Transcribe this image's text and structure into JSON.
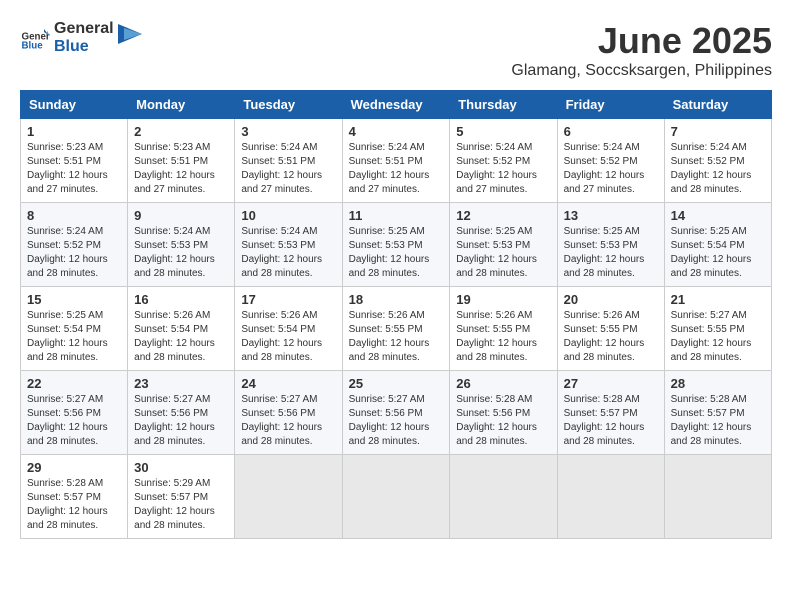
{
  "logo": {
    "general": "General",
    "blue": "Blue"
  },
  "title": {
    "month": "June 2025",
    "location": "Glamang, Soccsksargen, Philippines"
  },
  "weekdays": [
    "Sunday",
    "Monday",
    "Tuesday",
    "Wednesday",
    "Thursday",
    "Friday",
    "Saturday"
  ],
  "weeks": [
    [
      {
        "day": "1",
        "sunrise": "5:23 AM",
        "sunset": "5:51 PM",
        "daylight": "12 hours and 27 minutes."
      },
      {
        "day": "2",
        "sunrise": "5:23 AM",
        "sunset": "5:51 PM",
        "daylight": "12 hours and 27 minutes."
      },
      {
        "day": "3",
        "sunrise": "5:24 AM",
        "sunset": "5:51 PM",
        "daylight": "12 hours and 27 minutes."
      },
      {
        "day": "4",
        "sunrise": "5:24 AM",
        "sunset": "5:51 PM",
        "daylight": "12 hours and 27 minutes."
      },
      {
        "day": "5",
        "sunrise": "5:24 AM",
        "sunset": "5:52 PM",
        "daylight": "12 hours and 27 minutes."
      },
      {
        "day": "6",
        "sunrise": "5:24 AM",
        "sunset": "5:52 PM",
        "daylight": "12 hours and 27 minutes."
      },
      {
        "day": "7",
        "sunrise": "5:24 AM",
        "sunset": "5:52 PM",
        "daylight": "12 hours and 28 minutes."
      }
    ],
    [
      {
        "day": "8",
        "sunrise": "5:24 AM",
        "sunset": "5:52 PM",
        "daylight": "12 hours and 28 minutes."
      },
      {
        "day": "9",
        "sunrise": "5:24 AM",
        "sunset": "5:53 PM",
        "daylight": "12 hours and 28 minutes."
      },
      {
        "day": "10",
        "sunrise": "5:24 AM",
        "sunset": "5:53 PM",
        "daylight": "12 hours and 28 minutes."
      },
      {
        "day": "11",
        "sunrise": "5:25 AM",
        "sunset": "5:53 PM",
        "daylight": "12 hours and 28 minutes."
      },
      {
        "day": "12",
        "sunrise": "5:25 AM",
        "sunset": "5:53 PM",
        "daylight": "12 hours and 28 minutes."
      },
      {
        "day": "13",
        "sunrise": "5:25 AM",
        "sunset": "5:53 PM",
        "daylight": "12 hours and 28 minutes."
      },
      {
        "day": "14",
        "sunrise": "5:25 AM",
        "sunset": "5:54 PM",
        "daylight": "12 hours and 28 minutes."
      }
    ],
    [
      {
        "day": "15",
        "sunrise": "5:25 AM",
        "sunset": "5:54 PM",
        "daylight": "12 hours and 28 minutes."
      },
      {
        "day": "16",
        "sunrise": "5:26 AM",
        "sunset": "5:54 PM",
        "daylight": "12 hours and 28 minutes."
      },
      {
        "day": "17",
        "sunrise": "5:26 AM",
        "sunset": "5:54 PM",
        "daylight": "12 hours and 28 minutes."
      },
      {
        "day": "18",
        "sunrise": "5:26 AM",
        "sunset": "5:55 PM",
        "daylight": "12 hours and 28 minutes."
      },
      {
        "day": "19",
        "sunrise": "5:26 AM",
        "sunset": "5:55 PM",
        "daylight": "12 hours and 28 minutes."
      },
      {
        "day": "20",
        "sunrise": "5:26 AM",
        "sunset": "5:55 PM",
        "daylight": "12 hours and 28 minutes."
      },
      {
        "day": "21",
        "sunrise": "5:27 AM",
        "sunset": "5:55 PM",
        "daylight": "12 hours and 28 minutes."
      }
    ],
    [
      {
        "day": "22",
        "sunrise": "5:27 AM",
        "sunset": "5:56 PM",
        "daylight": "12 hours and 28 minutes."
      },
      {
        "day": "23",
        "sunrise": "5:27 AM",
        "sunset": "5:56 PM",
        "daylight": "12 hours and 28 minutes."
      },
      {
        "day": "24",
        "sunrise": "5:27 AM",
        "sunset": "5:56 PM",
        "daylight": "12 hours and 28 minutes."
      },
      {
        "day": "25",
        "sunrise": "5:27 AM",
        "sunset": "5:56 PM",
        "daylight": "12 hours and 28 minutes."
      },
      {
        "day": "26",
        "sunrise": "5:28 AM",
        "sunset": "5:56 PM",
        "daylight": "12 hours and 28 minutes."
      },
      {
        "day": "27",
        "sunrise": "5:28 AM",
        "sunset": "5:57 PM",
        "daylight": "12 hours and 28 minutes."
      },
      {
        "day": "28",
        "sunrise": "5:28 AM",
        "sunset": "5:57 PM",
        "daylight": "12 hours and 28 minutes."
      }
    ],
    [
      {
        "day": "29",
        "sunrise": "5:28 AM",
        "sunset": "5:57 PM",
        "daylight": "12 hours and 28 minutes."
      },
      {
        "day": "30",
        "sunrise": "5:29 AM",
        "sunset": "5:57 PM",
        "daylight": "12 hours and 28 minutes."
      },
      null,
      null,
      null,
      null,
      null
    ]
  ]
}
